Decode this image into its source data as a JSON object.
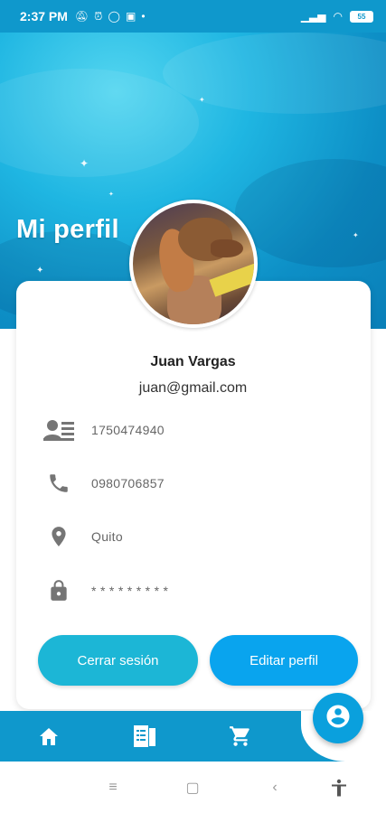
{
  "status_bar": {
    "time": "2:37 PM",
    "battery": "55",
    "icons": [
      "mute-icon",
      "alarm-icon",
      "whatsapp-icon",
      "app-icon",
      "dot-icon",
      "signal-icon",
      "wifi-icon",
      "battery-icon"
    ]
  },
  "header": {
    "title": "Mi perfil"
  },
  "profile": {
    "name": "Juan Vargas",
    "email": "juan@gmail.com",
    "fields": [
      {
        "icon": "id-card-icon",
        "value": "1750474940"
      },
      {
        "icon": "phone-icon",
        "value": "0980706857"
      },
      {
        "icon": "location-pin-icon",
        "value": "Quito"
      },
      {
        "icon": "lock-icon",
        "value": "* * * * * * * * *"
      }
    ]
  },
  "buttons": {
    "logout": "Cerrar sesión",
    "edit": "Editar perfil"
  },
  "bottom_nav": {
    "items": [
      "home-icon",
      "catalog-icon",
      "cart-icon"
    ],
    "fab_icon": "account-icon"
  },
  "system_nav": [
    "menu-icon",
    "home-square-icon",
    "back-icon",
    "accessibility-icon"
  ],
  "colors": {
    "primary": "#0f98cc",
    "logout_button": "#1cb6d6",
    "edit_button": "#09a4ee",
    "icon_grey": "#757575"
  }
}
